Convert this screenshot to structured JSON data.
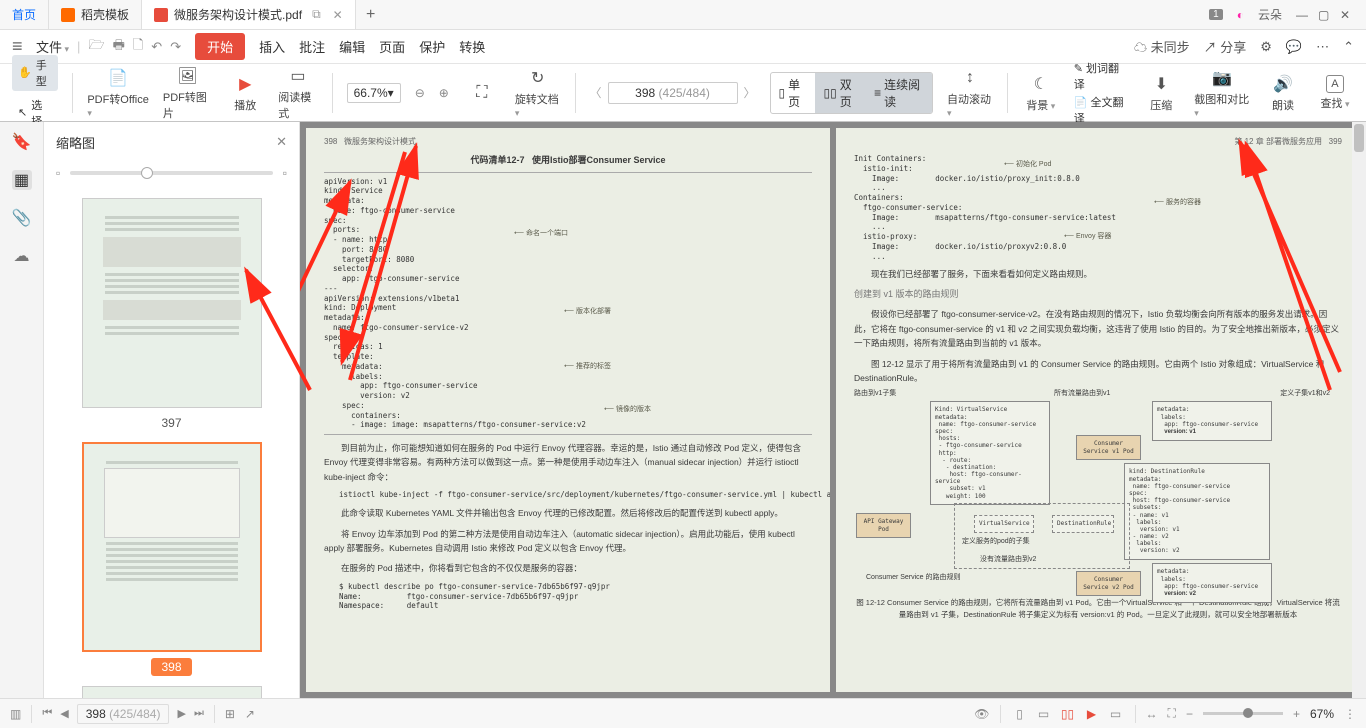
{
  "tabs": {
    "home": "首页",
    "template": "稻壳模板",
    "doc": "微服务架构设计模式.pdf",
    "user": "云朵",
    "badge": "1"
  },
  "menu": {
    "file": "文件",
    "start": "开始",
    "insert": "插入",
    "annotate": "批注",
    "edit": "编辑",
    "page": "页面",
    "protect": "保护",
    "convert": "转换",
    "unsync": "未同步",
    "share": "分享"
  },
  "toolbar": {
    "hand": "手型",
    "select": "选择",
    "pdf_office": "PDF转Office",
    "pdf_image": "PDF转图片",
    "play": "播放",
    "read_mode": "阅读模式",
    "zoom": "66.7%",
    "rotate": "旋转文档",
    "single": "单页",
    "double": "双页",
    "continuous": "连续阅读",
    "autoscroll": "自动滚动",
    "background": "背景",
    "translate_sel": "划词翻译",
    "translate_full": "全文翻译",
    "compress": "压缩",
    "screenshot": "截图和对比",
    "read_aloud": "朗读",
    "find": "查找",
    "page_current": "398",
    "page_total": "(425/484)"
  },
  "sidebar": {
    "title": "缩略图",
    "thumbs": [
      {
        "label": "397"
      },
      {
        "label": "398"
      }
    ]
  },
  "statusbar": {
    "page_current": "398",
    "page_total": "(425/484)",
    "zoom": "67%"
  },
  "doc": {
    "left_page_num": "398",
    "left_page_title": "微服务架构设计模式",
    "right_page_chapter": "第 12 章  部署微服务应用",
    "right_page_num": "399",
    "code_title_prefix": "代码清单12-7",
    "code_title_main": "使用Istio部署Consumer Service",
    "yaml1": "apiVersion: v1\nkind: Service\nmetadata:\n  name: ftgo-consumer-service\nspec:\n  ports:\n  - name: http\n    port: 8080\n    targetPort: 8080\n  selector:\n    app: ftgo-consumer-service\n---\napiVersion: extensions/v1beta1\nkind: Deployment\nmetadata:\n  name: ftgo-consumer-service-v2\nspec:\n  replicas: 1\n  template:\n    metadata:\n      labels:\n        app: ftgo-consumer-service\n        version: v2\n    spec:\n      containers:\n      - image: image: msapatterns/ftgo-consumer-service:v2",
    "ann_port": "命名一个端口",
    "ann_version_deploy": "版本化部署",
    "ann_recommend": "推荐的标签",
    "ann_image": "镜像的版本",
    "para1": "到目前为止，你可能想知道如何在服务的 Pod 中运行 Envoy 代理容器。幸运的是，Istio 通过自动修改 Pod 定义，使得包含 Envoy 代理变得非常容易。有两种方法可以做到这一点。第一种是使用手动边车注入（manual sidecar injection）并运行 istioctl kube-inject 命令：",
    "cmd1": "istioctl kube-inject -f ftgo-consumer-service/src/deployment/kubernetes/ftgo-consumer-service.yml | kubectl apply -f -",
    "para2": "此命令读取 Kubernetes YAML 文件并输出包含 Envoy 代理的已修改配置。然后将修改后的配置传送到 kubectl apply。",
    "para3": "将 Envoy 边车添加到 Pod 的第二种方法是使用自动边车注入（automatic sidecar injection）。启用此功能后，使用 kubectl apply 部署服务。Kubernetes 自动调用 Istio 来修改 Pod 定义以包含 Envoy 代理。",
    "para4": "在服务的 Pod 描述中，你将看到它包含的不仅仅是服务的容器：",
    "cmd2": "$ kubectl describe po ftgo-consumer-service-7db65b6f97-q9jpr\nName:          ftgo-consumer-service-7db65b6f97-q9jpr\nNamespace:     default",
    "init_containers": "Init Containers:\n  istio-init:\n    Image:        docker.io/istio/proxy_init:0.8.0\n    ...\nContainers:\n  ftgo-consumer-service:\n    Image:        msapatterns/ftgo-consumer-service:latest\n    ...\n  istio-proxy:\n    Image:        docker.io/istio/proxyv2:0.8.0\n    ...",
    "ann_init_pod": "初始化 Pod",
    "ann_svc_container": "服务的容器",
    "ann_envoy": "Envoy 容器",
    "para5": "现在我们已经部署了服务，下面来看看如何定义路由规则。",
    "h4_routing": "创建到 v1 版本的路由规则",
    "para6": "假设你已经部署了 ftgo-consumer-service-v2。在没有路由规则的情况下，Istio 负载均衡会向所有版本的服务发出请求。因此，它将在 ftgo-consumer-service 的 v1 和 v2 之间实现负载均衡，这违背了使用 Istio 的目的。为了安全地推出新版本，必须定义一下路由规则，将所有流量路由到当前的 v1 版本。",
    "para7": "图 12-12 显示了用于将所有流量路由到 v1 的 Consumer Service 的路由规则。它由两个 Istio 对象组成：VirtualService 和 DestinationRule。",
    "diag_route_v1": "路由到v1子集",
    "diag_all_v1": "所有流量路由到v1",
    "diag_define_sets": "定义子集v1和v2",
    "diag_api": "API Gateway Pod",
    "diag_vs": "VirtualService",
    "diag_dr": "DestinationRule",
    "diag_cs_v1": "Consumer Service v1 Pod",
    "diag_cs_v2": "Consumer Service v2 Pod",
    "diag_cs_rules": "Consumer Service 的路由规则",
    "diag_define_pod": "定义服务的pod的子集",
    "diag_no_route_v2": "没有流量路由到v2",
    "fig_caption": "图 12-12  Consumer Service 的路由规则，它将所有流量路由到 v1 Pod。它由一个VirtualService 和一个 DestinationRule 组成，VirtualService 将流量路由到 v1 子集，DestinationRule 将子集定义为标有 version:v1 的 Pod。一旦定义了此规则，就可以安全地部署新版本"
  }
}
